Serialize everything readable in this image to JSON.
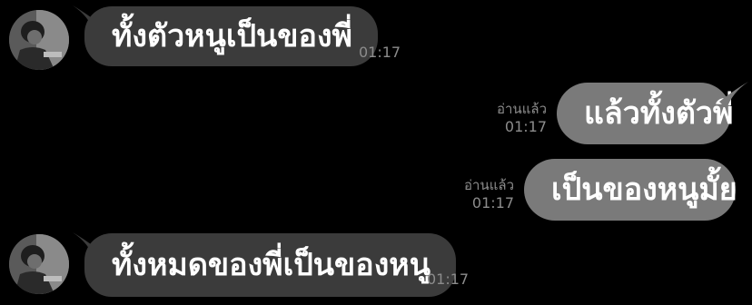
{
  "colors": {
    "background": "#000000",
    "incoming_bubble": "#3b3b3b",
    "outgoing_bubble": "#7a7a7a",
    "text": "#ffffff",
    "meta_text": "#8c8c8c"
  },
  "messages": [
    {
      "direction": "incoming",
      "text": "ทั้งตัวหนูเป็นของพี่",
      "time": "01:17",
      "avatar": "user-avatar"
    },
    {
      "direction": "outgoing",
      "text": "แล้วทั้งตัวพี่",
      "read_label": "อ่านแล้ว",
      "time": "01:17"
    },
    {
      "direction": "outgoing",
      "text": "เป็นของหนูมั้ย",
      "read_label": "อ่านแล้ว",
      "time": "01:17"
    },
    {
      "direction": "incoming",
      "text": "ทั้งหมดของพี่เป็นของหนู",
      "time": "01:17",
      "avatar": "user-avatar"
    }
  ]
}
